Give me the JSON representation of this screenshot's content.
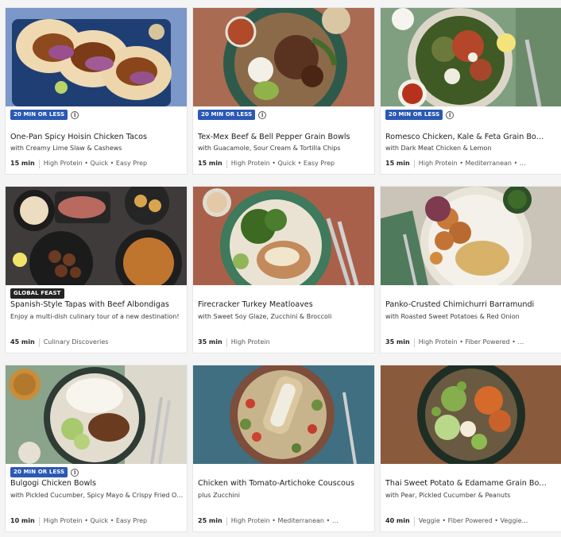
{
  "recipes": [
    {
      "badge": "20 MIN OR LESS",
      "title": "One-Pan Spicy Hoisin Chicken Tacos",
      "subtitle": "with Creamy Lime Slaw & Cashews",
      "time": "15 min",
      "tags": "High Protein • Quick • Easy Prep",
      "image": "tacos-photo"
    },
    {
      "badge": "20 MIN OR LESS",
      "title": "Tex-Mex Beef & Bell Pepper Grain Bowls",
      "subtitle": "with Guacamole, Sour Cream & Tortilla Chips",
      "time": "15 min",
      "tags": "High Protein • Quick • Easy Prep",
      "image": "grain-bowl-photo"
    },
    {
      "badge": "20 MIN OR LESS",
      "title": "Romesco Chicken, Kale & Feta Grain Bo…",
      "subtitle": "with Dark Meat Chicken & Lemon",
      "time": "15 min",
      "tags": "High Protein • Mediterranean • …",
      "image": "kale-bowl-photo"
    },
    {
      "badge": "GLOBAL FEAST",
      "title": "Spanish-Style Tapas with Beef Albondigas",
      "subtitle": "Enjoy a multi-dish culinary tour of a new destination!",
      "time": "45 min",
      "tags": "Culinary Discoveries",
      "image": "tapas-photo"
    },
    {
      "badge": "",
      "title": "Firecracker Turkey Meatloaves",
      "subtitle": "with Sweet Soy Glaze, Zucchini & Broccoli",
      "time": "35 min",
      "tags": "High Protein",
      "image": "meatloaf-photo"
    },
    {
      "badge": "",
      "title": "Panko-Crusted Chimichurri Barramundi",
      "subtitle": "with Roasted Sweet Potatoes & Red Onion",
      "time": "35 min",
      "tags": "High Protein • Fiber Powered • …",
      "image": "barramundi-photo"
    },
    {
      "badge": "20 MIN OR LESS",
      "title": "Bulgogi Chicken Bowls",
      "subtitle": "with Pickled Cucumber, Spicy Mayo & Crispy Fried O…",
      "time": "10 min",
      "tags": "High Protein • Quick • Easy Prep",
      "image": "bulgogi-photo"
    },
    {
      "badge": "",
      "title": "Chicken with Tomato-Artichoke Couscous",
      "subtitle": "plus Zucchini",
      "time": "25 min",
      "tags": "High Protein • Mediterranean • …",
      "image": "couscous-photo"
    },
    {
      "badge": "",
      "title": "Thai Sweet Potato & Edamame Grain Bo…",
      "subtitle": "with Pear, Pickled Cucumber & Peanuts",
      "time": "40 min",
      "tags": "Veggie • Fiber Powered • Veggie…",
      "image": "thai-bowl-photo"
    }
  ],
  "colors": {
    "quick_badge": "#2a59b5",
    "feast_badge": "#242424"
  }
}
